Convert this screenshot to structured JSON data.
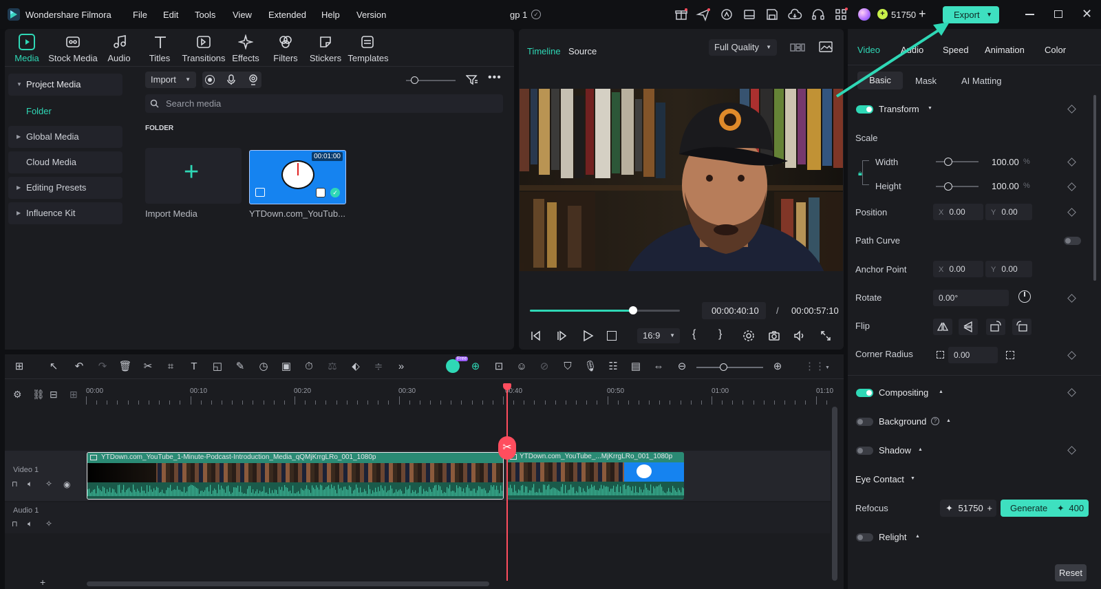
{
  "app": {
    "name": "Wondershare Filmora",
    "project": "gp 1"
  },
  "menu": [
    "File",
    "Edit",
    "Tools",
    "View",
    "Extended",
    "Help",
    "Version"
  ],
  "credits": "51750",
  "export_label": "Export",
  "media_tabs": [
    "Media",
    "Stock Media",
    "Audio",
    "Titles",
    "Transitions",
    "Effects",
    "Filters",
    "Stickers",
    "Templates"
  ],
  "sidebar": [
    {
      "label": "Project Media"
    },
    {
      "label": "Folder"
    },
    {
      "label": "Global Media"
    },
    {
      "label": "Cloud Media"
    },
    {
      "label": "Editing Presets"
    },
    {
      "label": "Influence Kit"
    }
  ],
  "media": {
    "import_label": "Import",
    "search_placeholder": "Search media",
    "folder_heading": "FOLDER",
    "import_media_label": "Import Media",
    "clip_name": "YTDown.com_YouTub...",
    "clip_duration": "00:01:00"
  },
  "preview": {
    "tab_timeline": "Timeline",
    "tab_source": "Source",
    "quality": "Full Quality",
    "current_time": "00:00:40:10",
    "separator": "/",
    "total_time": "00:00:57:10",
    "aspect": "16:9",
    "progress": 0.69
  },
  "props": {
    "tabs": [
      "Video",
      "Audio",
      "Speed",
      "Animation",
      "Color"
    ],
    "subtabs": [
      "Basic",
      "Mask",
      "AI Matting"
    ],
    "transform": "Transform",
    "scale": "Scale",
    "width_label": "Width",
    "width_value": "100.00",
    "height_label": "Height",
    "height_value": "100.00",
    "percent": "%",
    "position": "Position",
    "pos_x": "0.00",
    "pos_y": "0.00",
    "path_curve": "Path Curve",
    "anchor_point": "Anchor Point",
    "anchor_x": "0.00",
    "anchor_y": "0.00",
    "rotate": "Rotate",
    "rotate_value": "0.00°",
    "flip": "Flip",
    "corner_radius": "Corner Radius",
    "corner_value": "0.00",
    "compositing": "Compositing",
    "background": "Background",
    "shadow": "Shadow",
    "eye_contact": "Eye Contact",
    "refocus": "Refocus",
    "refocus_credits": "51750",
    "generate_label": "Generate",
    "generate_cost": "400",
    "relight": "Relight",
    "reset_label": "Reset",
    "x": "X",
    "y": "Y"
  },
  "timeline": {
    "ruler": [
      "00:00",
      "00:10",
      "00:20",
      "00:30",
      "00:40",
      "00:50",
      "01:00",
      "01:10"
    ],
    "video_track": "Video 1",
    "audio_track": "Audio 1",
    "clip1": "YTDown.com_YouTube_1-Minute-Podcast-Introduction_Media_qQMjKrrgLRo_001_1080p",
    "clip2": "YTDown.com_YouTube_...MjKrrgLRo_001_1080p",
    "free_badge": "Free"
  },
  "colors": {
    "accent": "#2fd8b6",
    "playhead": "#ff4d5e",
    "clip": "#2a8a74"
  }
}
